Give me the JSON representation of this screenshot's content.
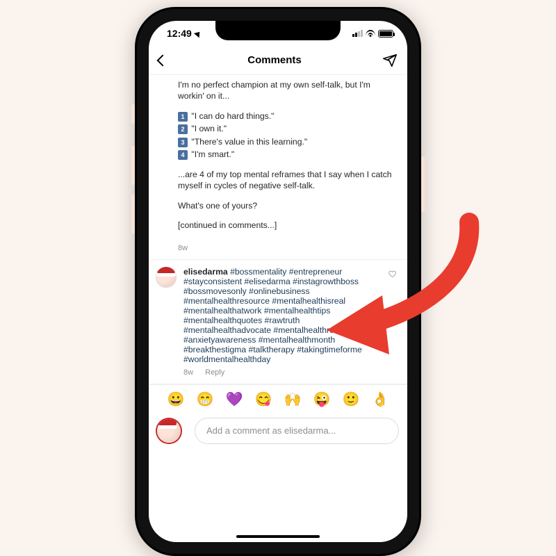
{
  "status": {
    "time": "12:49",
    "loc_arrow": "location-arrow"
  },
  "nav": {
    "back": "‹",
    "title": "Comments",
    "send": "paper-plane"
  },
  "caption": {
    "intro": "I'm no perfect champion at my own self-talk, but I'm workin' on it...",
    "points": [
      "\"I can do hard things.\"",
      "\"I own it.\"",
      "\"There's value in this learning.\"",
      "\"I'm smart.\""
    ],
    "mid": "...are 4 of my top mental reframes that I say when I catch myself in cycles of negative self-talk.",
    "prompt": "What's one of yours?",
    "continued": "[continued in comments...]",
    "age": "8w"
  },
  "comment": {
    "username": "elisedarma",
    "hashtags": [
      "#bossmentality",
      "#entrepreneur",
      "#stayconsistent",
      "#elisedarma",
      "#instagrowthboss",
      "#bossmovesonly",
      "#onlinebusiness",
      "#mentalhealthresource",
      "#mentalhealthisreal",
      "#mentalhealthatwork",
      "#mentalhealthtips",
      "#mentalhealthquotes",
      "#rawtruth",
      "#mentalhealthadvocate",
      "#mentalhealthrecovery",
      "#anxietyawareness",
      "#mentalhealthmonth",
      "#breakthestigma",
      "#talktherapy",
      "#takingtimeforme",
      "#worldmentalhealthday"
    ],
    "age": "8w",
    "reply_label": "Reply"
  },
  "emoji_bar": [
    "😀",
    "😁",
    "💜",
    "😋",
    "🙌",
    "😜",
    "🙂",
    "👌"
  ],
  "composer": {
    "placeholder": "Add a comment as elisedarma..."
  },
  "colors": {
    "hashtag": "#1b3a57",
    "arrow": "#e83c2e"
  }
}
